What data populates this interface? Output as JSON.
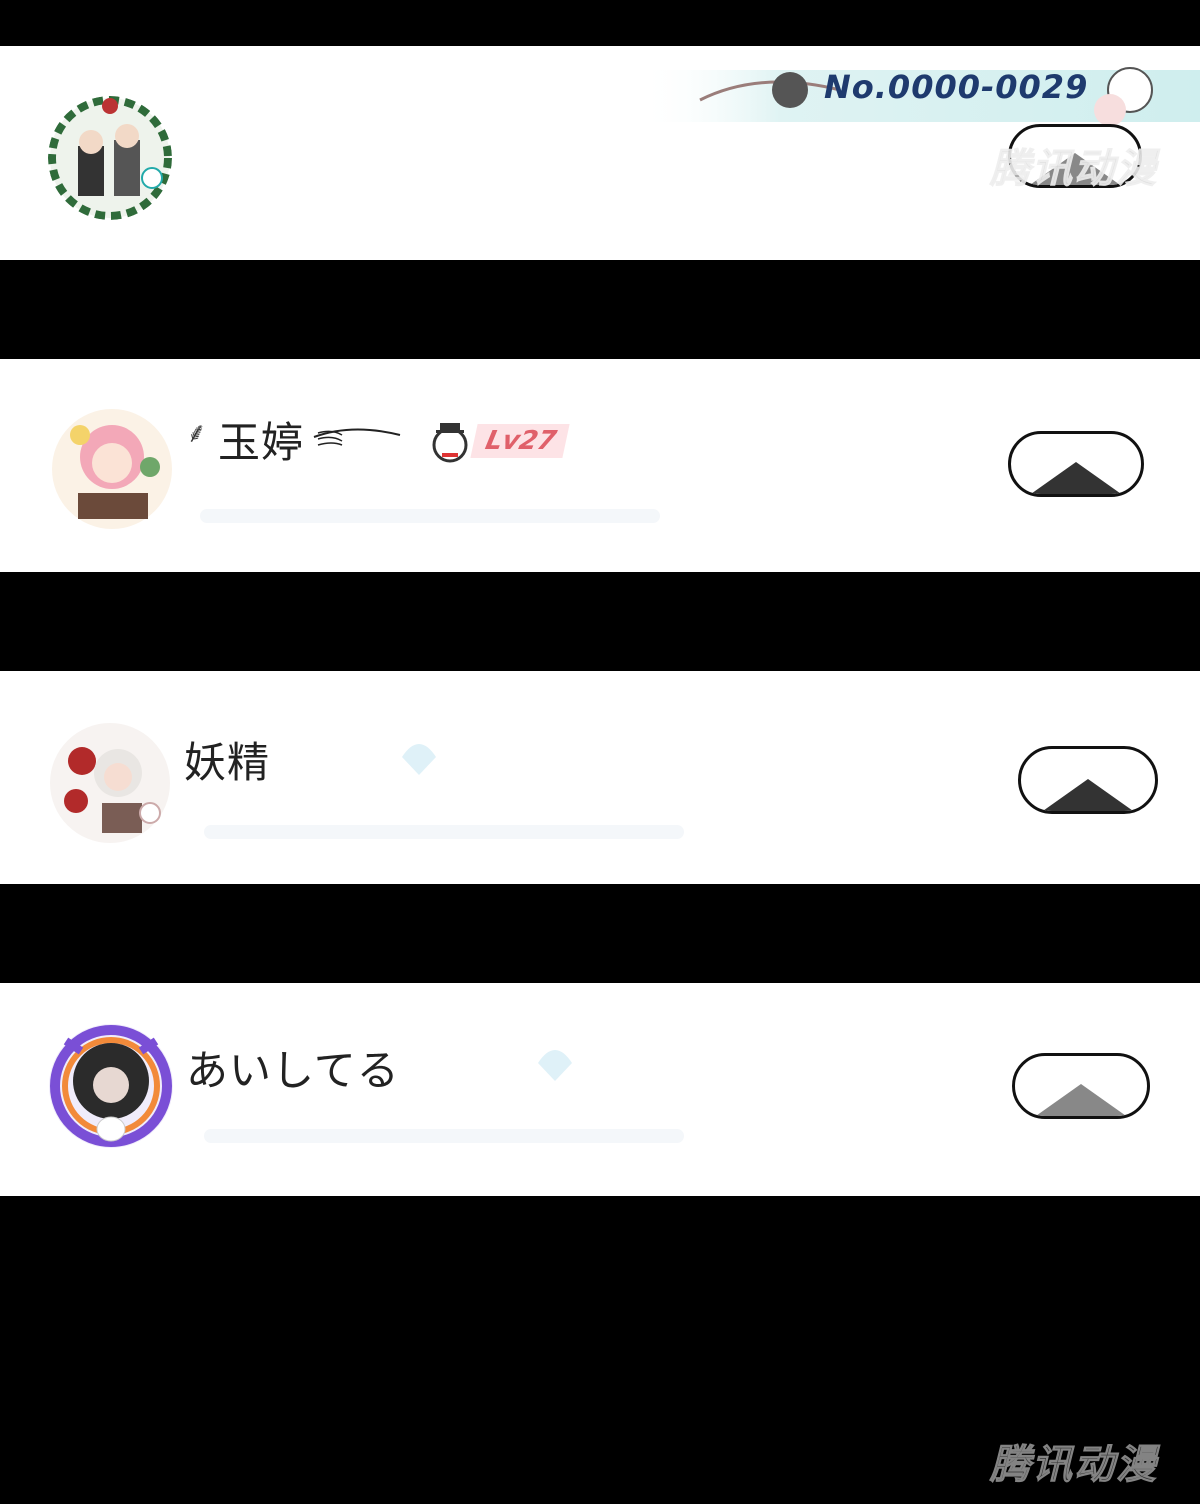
{
  "header_card": {
    "badge_number": "No.0000-0029",
    "watermark": "腾讯动漫"
  },
  "rows": [
    {
      "name": "玉婷",
      "level": "Lv27"
    },
    {
      "name": "妖精"
    },
    {
      "name": "あいしてる"
    }
  ],
  "footer": {
    "watermark": "腾讯动漫"
  },
  "colors": {
    "background": "#000000",
    "card": "#ffffff",
    "level_badge": "#e0606a",
    "banner_accent": "#1e3a6e"
  }
}
